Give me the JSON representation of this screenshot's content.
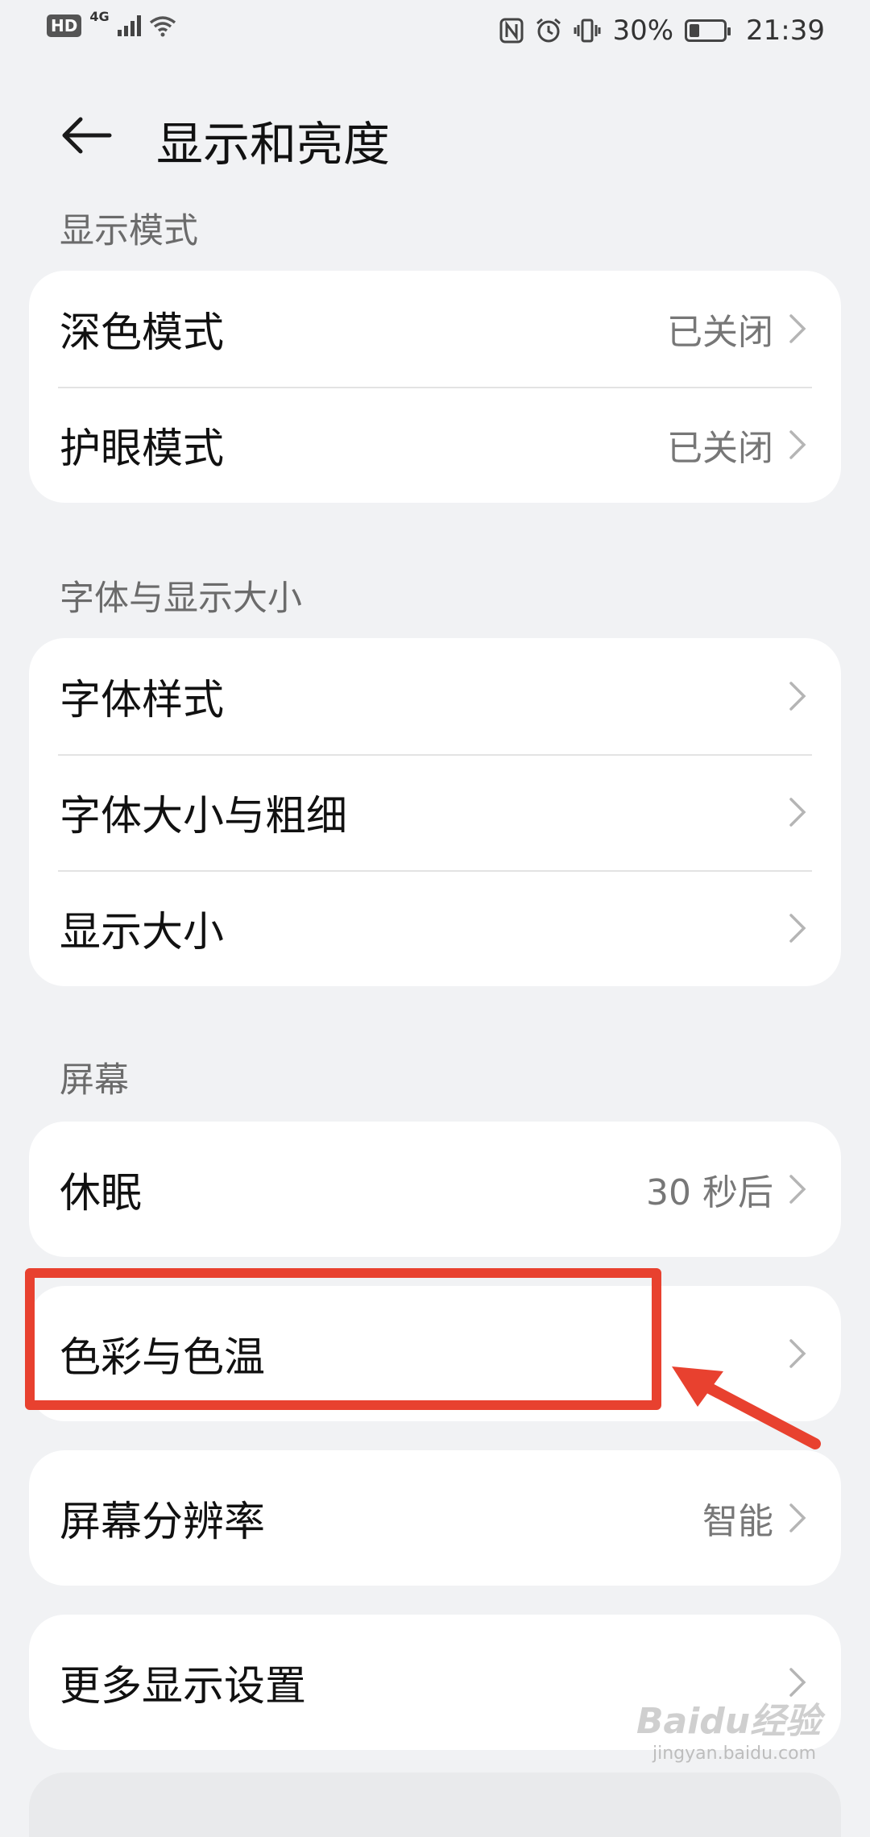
{
  "status_bar": {
    "hd": "HD",
    "network": "4G",
    "battery_text": "30%",
    "battery_level": 0.3,
    "time": "21:39"
  },
  "header": {
    "title": "显示和亮度"
  },
  "sections": {
    "display_mode": {
      "label": "显示模式",
      "items": [
        {
          "label": "深色模式",
          "value": "已关闭"
        },
        {
          "label": "护眼模式",
          "value": "已关闭"
        }
      ]
    },
    "font_size": {
      "label": "字体与显示大小",
      "items": [
        {
          "label": "字体样式"
        },
        {
          "label": "字体大小与粗细"
        },
        {
          "label": "显示大小"
        }
      ]
    },
    "screen": {
      "label": "屏幕",
      "items": [
        {
          "label": "休眠",
          "value": "30 秒后"
        },
        {
          "label": "色彩与色温"
        },
        {
          "label": "屏幕分辨率",
          "value": "智能"
        },
        {
          "label": "更多显示设置"
        }
      ]
    }
  },
  "watermark": {
    "brand": "Baidu经验",
    "site": "jingyan.baidu.com"
  },
  "colors": {
    "highlight": "#e8412f",
    "background": "#f1f2f4",
    "card": "#ffffff"
  }
}
